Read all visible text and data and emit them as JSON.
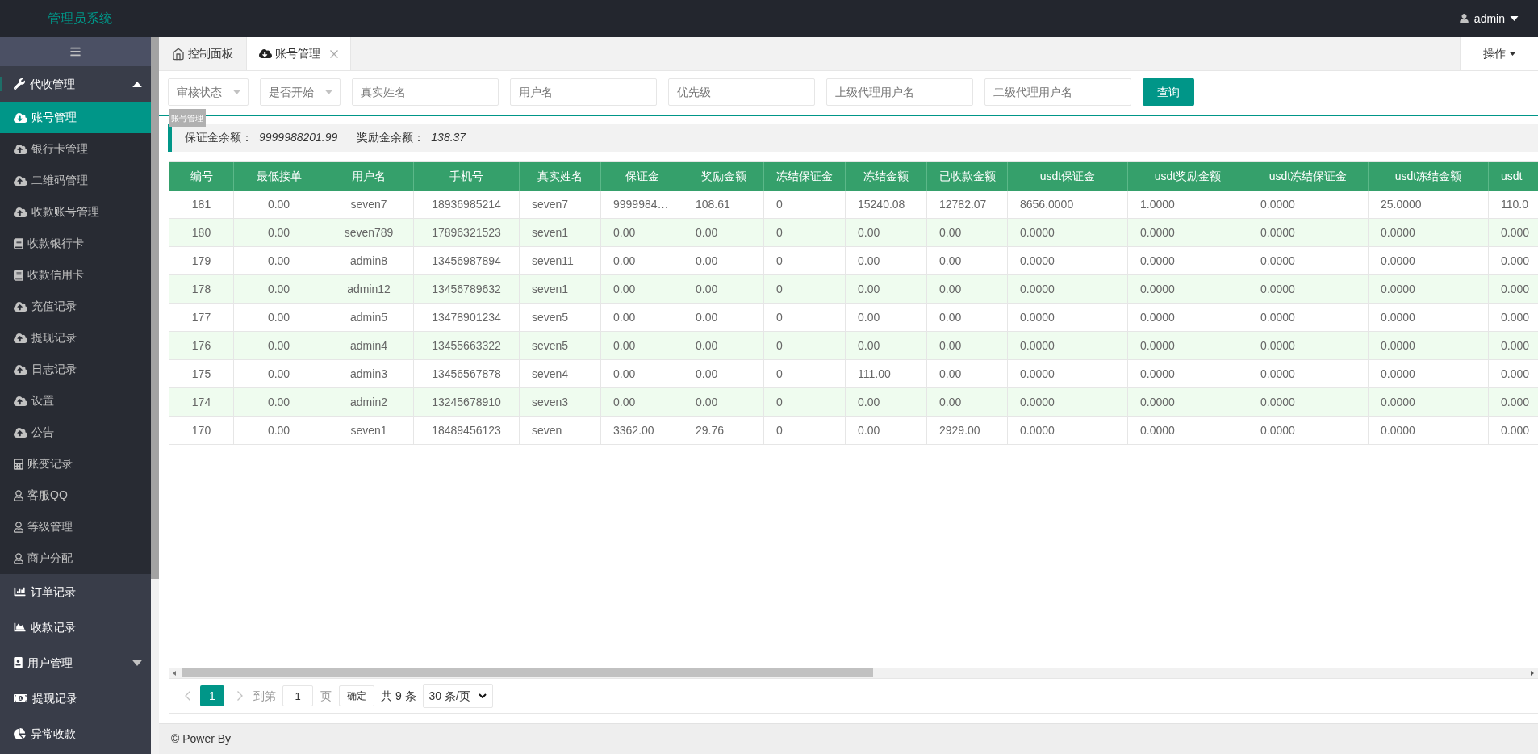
{
  "header": {
    "title": "管理员系统",
    "user": "admin"
  },
  "sidebar": {
    "items": [
      {
        "kind": "group",
        "label": "代收管理",
        "selected": false,
        "expanded": true,
        "children": [
          {
            "label": "账号管理",
            "selected": true
          },
          {
            "label": "银行卡管理",
            "selected": false
          },
          {
            "label": "二维码管理",
            "selected": false
          },
          {
            "label": "收款账号管理",
            "selected": false
          },
          {
            "label": "收款银行卡",
            "selected": false
          },
          {
            "label": "收款信用卡",
            "selected": false
          },
          {
            "label": "充值记录",
            "selected": false
          },
          {
            "label": "提现记录",
            "selected": false
          },
          {
            "label": "日志记录",
            "selected": false
          },
          {
            "label": "设置",
            "selected": false
          },
          {
            "label": "公告",
            "selected": false
          },
          {
            "label": "账变记录",
            "selected": false
          },
          {
            "label": "客服QQ",
            "selected": false
          },
          {
            "label": "等级管理",
            "selected": false
          },
          {
            "label": "商户分配",
            "selected": false
          }
        ]
      },
      {
        "kind": "link",
        "label": "订单记录",
        "selected": false
      },
      {
        "kind": "link",
        "label": "收款记录",
        "selected": false
      },
      {
        "kind": "group",
        "label": "用户管理",
        "selected": false,
        "expanded": false
      },
      {
        "kind": "link",
        "label": "提现记录",
        "selected": false
      },
      {
        "kind": "link",
        "label": "异常收款",
        "selected": false
      }
    ]
  },
  "tabs": [
    {
      "label": "控制面板",
      "selected": false
    },
    {
      "label": "账号管理",
      "selected": true
    }
  ],
  "tab_menu": "操作",
  "tooltip": "账号管理",
  "filters": [
    {
      "kind": "select",
      "placeholder": "审核状态"
    },
    {
      "kind": "select",
      "placeholder": "是否开始"
    },
    {
      "kind": "input",
      "placeholder": "真实姓名"
    },
    {
      "kind": "input",
      "placeholder": "用户名"
    },
    {
      "kind": "input",
      "placeholder": "优先级"
    },
    {
      "kind": "input",
      "placeholder": "上级代理用户名"
    },
    {
      "kind": "input",
      "placeholder": "二级代理用户名"
    }
  ],
  "search_button": "查询",
  "summary": [
    {
      "label": "保证金余额：",
      "value": "9999988201.99"
    },
    {
      "label": "奖励金余额：",
      "value": "138.37"
    }
  ],
  "table": {
    "columns": [
      "编号",
      "最低接单",
      "用户名",
      "手机号",
      "真实姓名",
      "保证金",
      "奖励金额",
      "冻结保证金",
      "冻结金额",
      "已收款金额",
      "usdt保证金",
      "usdt奖励金额",
      "usdt冻结保证金",
      "usdt冻结金额",
      "usdt"
    ],
    "rows": [
      [
        "181",
        "0.00",
        "seven7",
        "18936985214",
        "seven7",
        "9999984…",
        "108.61",
        "0",
        "15240.08",
        "12782.07",
        "8656.0000",
        "1.0000",
        "0.0000",
        "25.0000",
        "110.0"
      ],
      [
        "180",
        "0.00",
        "seven789",
        "17896321523",
        "seven1",
        "0.00",
        "0.00",
        "0",
        "0.00",
        "0.00",
        "0.0000",
        "0.0000",
        "0.0000",
        "0.0000",
        "0.000"
      ],
      [
        "179",
        "0.00",
        "admin8",
        "13456987894",
        "seven11",
        "0.00",
        "0.00",
        "0",
        "0.00",
        "0.00",
        "0.0000",
        "0.0000",
        "0.0000",
        "0.0000",
        "0.000"
      ],
      [
        "178",
        "0.00",
        "admin12",
        "13456789632",
        "seven1",
        "0.00",
        "0.00",
        "0",
        "0.00",
        "0.00",
        "0.0000",
        "0.0000",
        "0.0000",
        "0.0000",
        "0.000"
      ],
      [
        "177",
        "0.00",
        "admin5",
        "13478901234",
        "seven5",
        "0.00",
        "0.00",
        "0",
        "0.00",
        "0.00",
        "0.0000",
        "0.0000",
        "0.0000",
        "0.0000",
        "0.000"
      ],
      [
        "176",
        "0.00",
        "admin4",
        "13455663322",
        "seven5",
        "0.00",
        "0.00",
        "0",
        "0.00",
        "0.00",
        "0.0000",
        "0.0000",
        "0.0000",
        "0.0000",
        "0.000"
      ],
      [
        "175",
        "0.00",
        "admin3",
        "13456567878",
        "seven4",
        "0.00",
        "0.00",
        "0",
        "111.00",
        "0.00",
        "0.0000",
        "0.0000",
        "0.0000",
        "0.0000",
        "0.000"
      ],
      [
        "174",
        "0.00",
        "admin2",
        "13245678910",
        "seven3",
        "0.00",
        "0.00",
        "0",
        "0.00",
        "0.00",
        "0.0000",
        "0.0000",
        "0.0000",
        "0.0000",
        "0.000"
      ],
      [
        "170",
        "0.00",
        "seven1",
        "18489456123",
        "seven",
        "3362.00",
        "29.76",
        "0",
        "0.00",
        "2929.00",
        "0.0000",
        "0.0000",
        "0.0000",
        "0.0000",
        "0.000"
      ]
    ]
  },
  "pagination": {
    "previous": {
      "disabled": true
    },
    "pages": [
      {
        "label": "1",
        "selected": true
      }
    ],
    "next": {
      "disabled": true
    },
    "goto_label": "到第",
    "goto_value": "1",
    "page_unit": "页",
    "confirm": "确定",
    "total": "共 9 条",
    "page_size": "30 条/页"
  },
  "footer": "© Power By"
}
